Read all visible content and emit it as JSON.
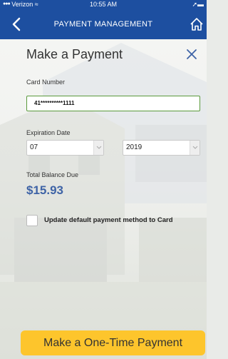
{
  "status_bar": {
    "carrier": "Verizon",
    "time": "10:55 AM"
  },
  "nav": {
    "title": "PAYMENT MANAGEMENT",
    "back_icon": "chevron-left-icon",
    "home_icon": "home-icon"
  },
  "form": {
    "heading": "Make a Payment",
    "card_number_label": "Card Number",
    "card_number_value": "41**********1111",
    "expiration_label": "Expiration Date",
    "exp_month": "07",
    "exp_year": "2019",
    "balance_label": "Total Balance Due",
    "balance_value": "$15.93",
    "default_checkbox_label": "Update default payment method to Card",
    "default_checkbox_checked": false
  },
  "actions": {
    "pay_button": "Make a One-Time Payment"
  },
  "colors": {
    "nav_bg": "#1d4fa0",
    "accent_blue": "#3e63a6",
    "input_border_focus": "#5a9a3c",
    "pay_button_bg": "#fdc52c"
  }
}
